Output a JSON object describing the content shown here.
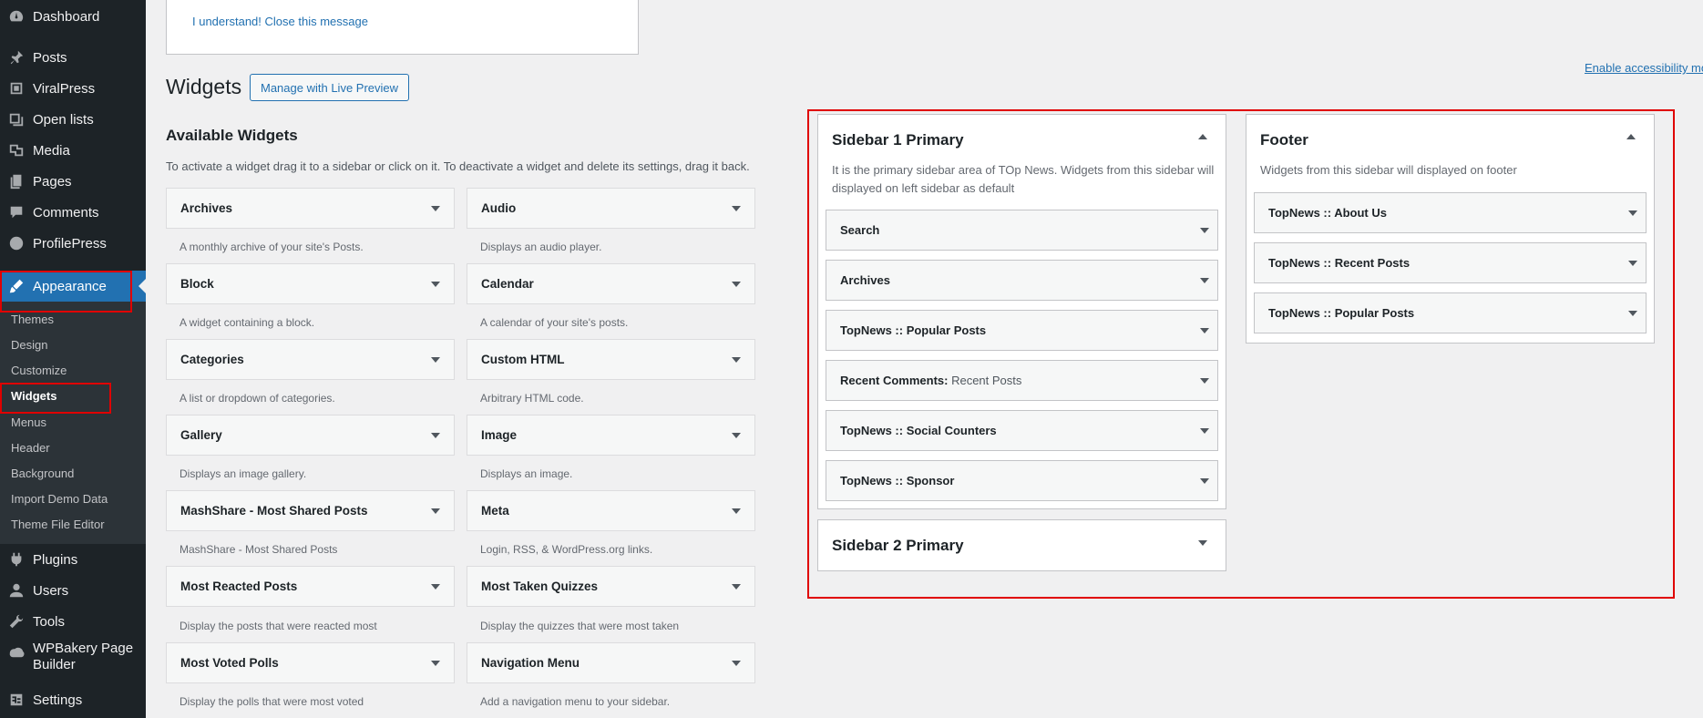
{
  "admin_menu": {
    "items": [
      {
        "label": "Dashboard",
        "icon": "dashboard-icon"
      },
      {
        "label": "Posts",
        "icon": "pin-icon"
      },
      {
        "label": "ViralPress",
        "icon": "viralpress-icon"
      },
      {
        "label": "Open lists",
        "icon": "list-icon"
      },
      {
        "label": "Media",
        "icon": "media-icon"
      },
      {
        "label": "Pages",
        "icon": "pages-icon"
      },
      {
        "label": "Comments",
        "icon": "comment-icon"
      },
      {
        "label": "ProfilePress",
        "icon": "profilepress-icon"
      },
      {
        "label": "Appearance",
        "icon": "brush-icon"
      },
      {
        "label": "Plugins",
        "icon": "plugin-icon"
      },
      {
        "label": "Users",
        "icon": "user-icon"
      },
      {
        "label": "Tools",
        "icon": "wrench-icon"
      },
      {
        "label": "WPBakery Page",
        "label2": "Builder",
        "icon": "wpbakery-icon"
      },
      {
        "label": "Settings",
        "icon": "settings-icon"
      }
    ],
    "submenu": [
      "Themes",
      "Design",
      "Customize",
      "Widgets",
      "Menus",
      "Header",
      "Background",
      "Import Demo Data",
      "Theme File Editor"
    ]
  },
  "notice": {
    "link": "I understand! Close this message"
  },
  "header": {
    "title": "Widgets",
    "live_preview": "Manage with Live Preview",
    "accessibility_link": "Enable accessibility mode"
  },
  "available": {
    "title": "Available Widgets",
    "description": "To activate a widget drag it to a sidebar or click on it. To deactivate a widget and delete its settings, drag it back.",
    "widgets": [
      {
        "title": "Archives",
        "desc": "A monthly archive of your site's Posts."
      },
      {
        "title": "Audio",
        "desc": "Displays an audio player."
      },
      {
        "title": "Block",
        "desc": "A widget containing a block."
      },
      {
        "title": "Calendar",
        "desc": "A calendar of your site's posts."
      },
      {
        "title": "Categories",
        "desc": "A list or dropdown of categories."
      },
      {
        "title": "Custom HTML",
        "desc": "Arbitrary HTML code."
      },
      {
        "title": "Gallery",
        "desc": "Displays an image gallery."
      },
      {
        "title": "Image",
        "desc": "Displays an image."
      },
      {
        "title": "MashShare - Most Shared Posts",
        "desc": "MashShare - Most Shared Posts"
      },
      {
        "title": "Meta",
        "desc": "Login, RSS, & WordPress.org links."
      },
      {
        "title": "Most Reacted Posts",
        "desc": "Display the posts that were reacted most"
      },
      {
        "title": "Most Taken Quizzes",
        "desc": "Display the quizzes that were most taken"
      },
      {
        "title": "Most Voted Polls",
        "desc": "Display the polls that were most voted"
      },
      {
        "title": "Navigation Menu",
        "desc": "Add a navigation menu to your sidebar."
      }
    ]
  },
  "sidebars": {
    "primary1": {
      "title": "Sidebar 1 Primary",
      "desc_line1": "It is the primary sidebar area of TOp News. Widgets from this sidebar will",
      "desc_line2": "displayed on left sidebar as default",
      "widgets": [
        {
          "title": "Search",
          "sub": ""
        },
        {
          "title": "Archives",
          "sub": ""
        },
        {
          "title": "TopNews :: Popular Posts",
          "sub": ""
        },
        {
          "title": "Recent Comments:",
          "sub": " Recent Posts"
        },
        {
          "title": "TopNews :: Social Counters",
          "sub": ""
        },
        {
          "title": "TopNews :: Sponsor",
          "sub": ""
        }
      ]
    },
    "primary2": {
      "title": "Sidebar 2 Primary"
    },
    "footer": {
      "title": "Footer",
      "desc": "Widgets from this sidebar will displayed on footer",
      "widgets": [
        {
          "title": "TopNews :: About Us"
        },
        {
          "title": "TopNews :: Recent Posts"
        },
        {
          "title": "TopNews :: Popular Posts"
        }
      ]
    }
  },
  "colors": {
    "accent": "#2271b1",
    "menu_bg": "#1d2327",
    "highlight": "#e00000"
  }
}
